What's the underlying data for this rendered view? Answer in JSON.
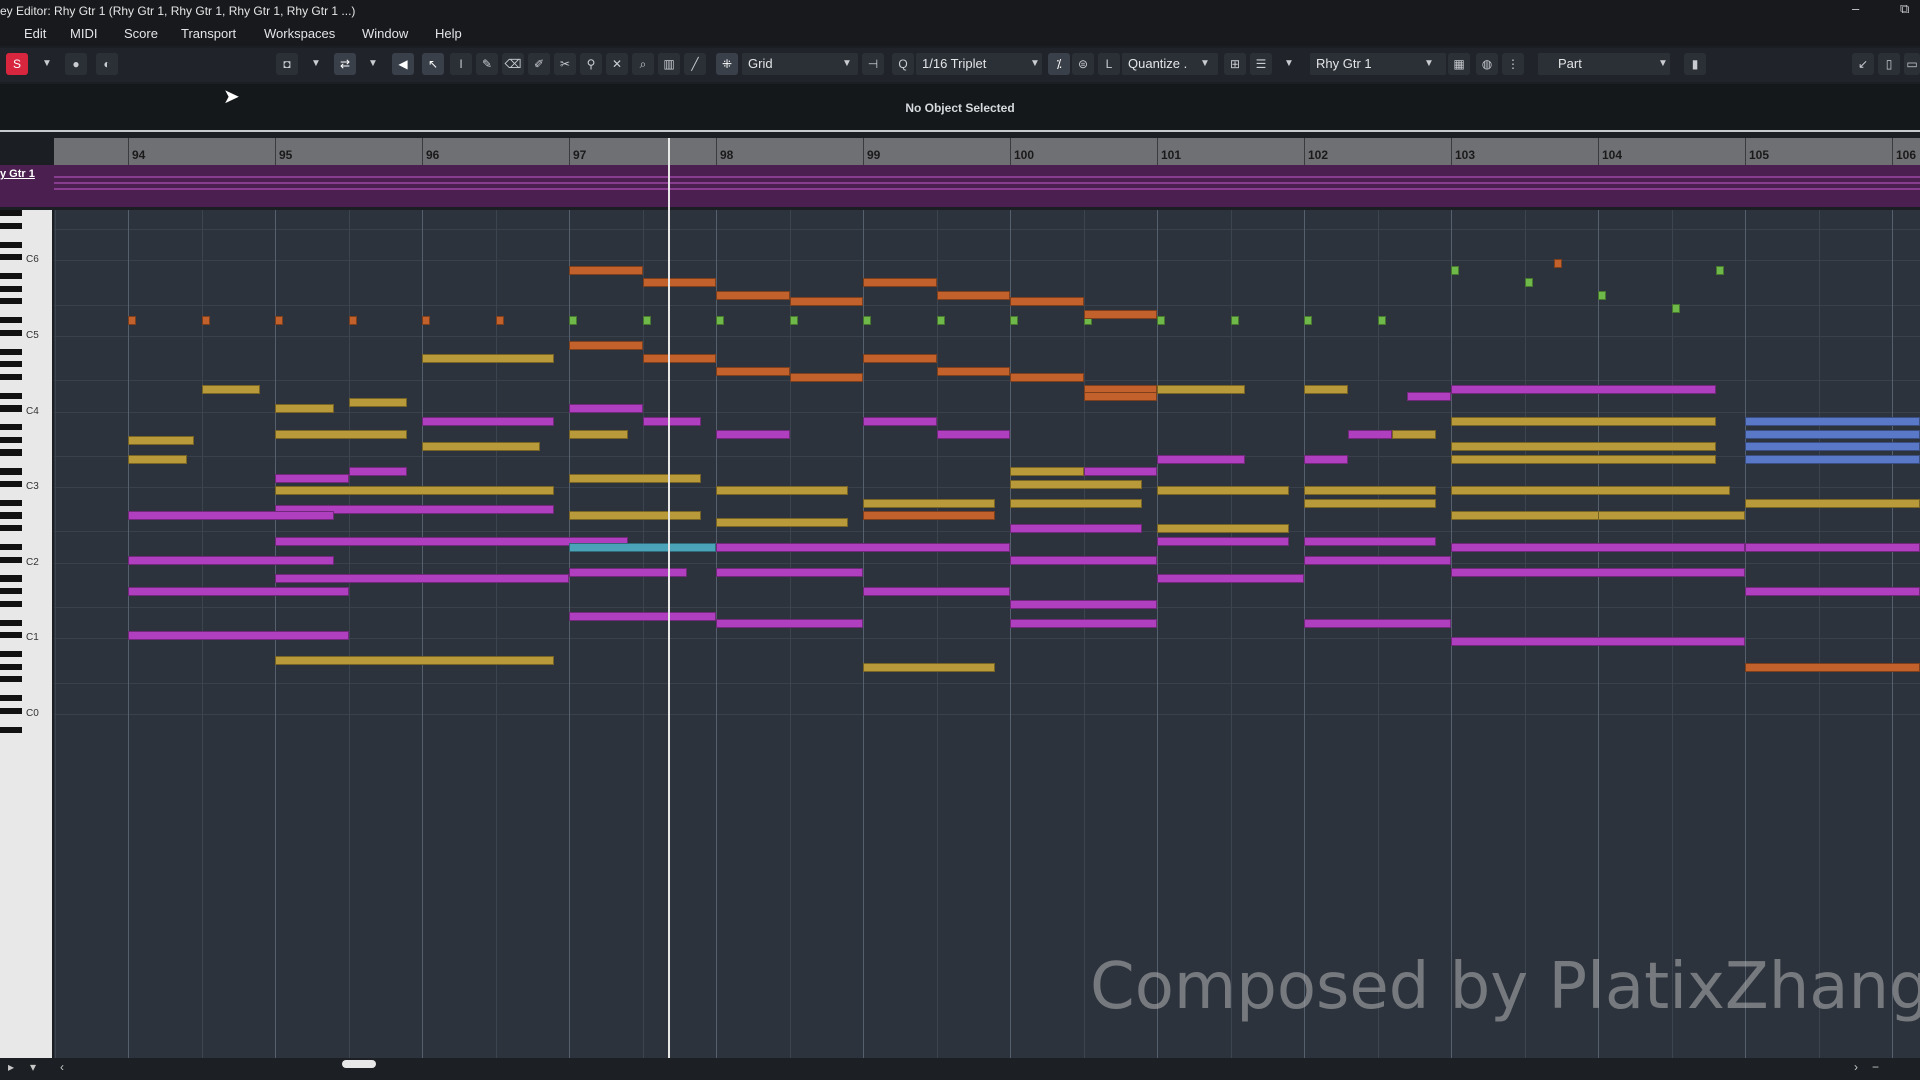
{
  "window": {
    "title": "ey Editor: Rhy Gtr 1 (Rhy Gtr 1, Rhy Gtr 1, Rhy Gtr 1, Rhy Gtr 1 ...)",
    "controls": [
      "–",
      "⧉"
    ]
  },
  "menu": [
    "Edit",
    "MIDI",
    "Score",
    "Transport",
    "Workspaces",
    "Window",
    "Help"
  ],
  "toolbar": {
    "grid_label": "Grid",
    "quantize_value": "1/16  Triplet",
    "quantize_label": "Quantize .",
    "track_select": "Rhy Gtr 1",
    "part_label": "Part",
    "q_icon": "Q",
    "l_icon": "L"
  },
  "info_line": "No Object Selected",
  "ruler": {
    "bars": [
      "94",
      "95",
      "96",
      "97",
      "98",
      "99",
      "100",
      "101",
      "102",
      "103",
      "104",
      "105",
      "106"
    ]
  },
  "track_label": "y Gtr 1",
  "keyboard": {
    "octave_labels": [
      "C6",
      "C5",
      "C4",
      "C3",
      "C2",
      "C1",
      "C0"
    ]
  },
  "watermark": "Composed by PlatixZhang",
  "colors": {
    "olive": "#b89a3a",
    "magenta": "#b03fbf",
    "orange": "#c2612c",
    "green": "#6fb84a",
    "blue": "#5a78c8",
    "teal": "#4aa3b8",
    "record": "#d8263f"
  },
  "notes": [
    {
      "bar": 94.0,
      "len": 0.05,
      "pitch": 75,
      "color": "orange"
    },
    {
      "bar": 94.5,
      "len": 0.05,
      "pitch": 75,
      "color": "orange"
    },
    {
      "bar": 95.0,
      "len": 0.05,
      "pitch": 75,
      "color": "orange"
    },
    {
      "bar": 95.5,
      "len": 0.05,
      "pitch": 75,
      "color": "orange"
    },
    {
      "bar": 96.0,
      "len": 0.05,
      "pitch": 75,
      "color": "orange"
    },
    {
      "bar": 96.5,
      "len": 0.05,
      "pitch": 75,
      "color": "orange"
    },
    {
      "bar": 97.0,
      "len": 0.05,
      "pitch": 75,
      "color": "green"
    },
    {
      "bar": 97.5,
      "len": 0.05,
      "pitch": 75,
      "color": "green"
    },
    {
      "bar": 98.0,
      "len": 0.05,
      "pitch": 75,
      "color": "green"
    },
    {
      "bar": 98.5,
      "len": 0.05,
      "pitch": 75,
      "color": "green"
    },
    {
      "bar": 99.0,
      "len": 0.05,
      "pitch": 75,
      "color": "green"
    },
    {
      "bar": 99.5,
      "len": 0.05,
      "pitch": 75,
      "color": "green"
    },
    {
      "bar": 100.0,
      "len": 0.05,
      "pitch": 75,
      "color": "green"
    },
    {
      "bar": 100.5,
      "len": 0.05,
      "pitch": 75,
      "color": "green"
    },
    {
      "bar": 101.0,
      "len": 0.05,
      "pitch": 75,
      "color": "green"
    },
    {
      "bar": 101.5,
      "len": 0.05,
      "pitch": 75,
      "color": "green"
    },
    {
      "bar": 102.0,
      "len": 0.05,
      "pitch": 75,
      "color": "green"
    },
    {
      "bar": 102.5,
      "len": 0.05,
      "pitch": 75,
      "color": "green"
    },
    {
      "bar": 103.7,
      "len": 0.05,
      "pitch": 84,
      "color": "orange"
    },
    {
      "bar": 104.8,
      "len": 0.05,
      "pitch": 83,
      "color": "green"
    },
    {
      "bar": 103.0,
      "len": 0.05,
      "pitch": 83,
      "color": "green"
    },
    {
      "bar": 103.5,
      "len": 0.05,
      "pitch": 81,
      "color": "green"
    },
    {
      "bar": 104.0,
      "len": 0.05,
      "pitch": 79,
      "color": "green"
    },
    {
      "bar": 104.5,
      "len": 0.05,
      "pitch": 77,
      "color": "green"
    },
    {
      "bar": 97.0,
      "len": 0.5,
      "pitch": 83,
      "color": "orange"
    },
    {
      "bar": 97.5,
      "len": 0.5,
      "pitch": 81,
      "color": "orange"
    },
    {
      "bar": 98.0,
      "len": 0.5,
      "pitch": 79,
      "color": "orange"
    },
    {
      "bar": 98.5,
      "len": 0.5,
      "pitch": 78,
      "color": "orange"
    },
    {
      "bar": 99.0,
      "len": 0.5,
      "pitch": 81,
      "color": "orange"
    },
    {
      "bar": 99.5,
      "len": 0.5,
      "pitch": 79,
      "color": "orange"
    },
    {
      "bar": 100.0,
      "len": 0.5,
      "pitch": 78,
      "color": "orange"
    },
    {
      "bar": 100.5,
      "len": 0.5,
      "pitch": 76,
      "color": "orange"
    },
    {
      "bar": 97.0,
      "len": 0.5,
      "pitch": 71,
      "color": "orange"
    },
    {
      "bar": 97.5,
      "len": 0.5,
      "pitch": 69,
      "color": "orange"
    },
    {
      "bar": 98.0,
      "len": 0.5,
      "pitch": 67,
      "color": "orange"
    },
    {
      "bar": 98.5,
      "len": 0.5,
      "pitch": 66,
      "color": "orange"
    },
    {
      "bar": 99.0,
      "len": 0.5,
      "pitch": 69,
      "color": "orange"
    },
    {
      "bar": 99.5,
      "len": 0.5,
      "pitch": 67,
      "color": "orange"
    },
    {
      "bar": 100.0,
      "len": 0.5,
      "pitch": 66,
      "color": "orange"
    },
    {
      "bar": 100.5,
      "len": 0.5,
      "pitch": 64,
      "color": "orange"
    },
    {
      "bar": 96.0,
      "len": 0.9,
      "pitch": 69,
      "color": "olive"
    },
    {
      "bar": 94.5,
      "len": 0.4,
      "pitch": 64,
      "color": "olive"
    },
    {
      "bar": 95.5,
      "len": 0.4,
      "pitch": 62,
      "color": "olive"
    },
    {
      "bar": 95.0,
      "len": 0.4,
      "pitch": 61,
      "color": "olive"
    },
    {
      "bar": 97.0,
      "len": 0.5,
      "pitch": 61,
      "color": "magenta"
    },
    {
      "bar": 96.0,
      "len": 0.9,
      "pitch": 59,
      "color": "magenta"
    },
    {
      "bar": 97.5,
      "len": 0.4,
      "pitch": 59,
      "color": "magenta"
    },
    {
      "bar": 99.0,
      "len": 0.5,
      "pitch": 59,
      "color": "magenta"
    },
    {
      "bar": 95.0,
      "len": 0.9,
      "pitch": 57,
      "color": "olive"
    },
    {
      "bar": 97.0,
      "len": 0.4,
      "pitch": 57,
      "color": "olive"
    },
    {
      "bar": 98.0,
      "len": 0.5,
      "pitch": 57,
      "color": "magenta"
    },
    {
      "bar": 99.5,
      "len": 0.5,
      "pitch": 57,
      "color": "magenta"
    },
    {
      "bar": 94.0,
      "len": 0.45,
      "pitch": 56,
      "color": "olive"
    },
    {
      "bar": 96.0,
      "len": 0.8,
      "pitch": 55,
      "color": "olive"
    },
    {
      "bar": 94.0,
      "len": 0.4,
      "pitch": 53,
      "color": "olive"
    },
    {
      "bar": 95.0,
      "len": 0.5,
      "pitch": 50,
      "color": "magenta"
    },
    {
      "bar": 95.5,
      "len": 0.4,
      "pitch": 51,
      "color": "magenta"
    },
    {
      "bar": 97.0,
      "len": 0.9,
      "pitch": 50,
      "color": "olive"
    },
    {
      "bar": 95.0,
      "len": 1.9,
      "pitch": 48,
      "color": "olive"
    },
    {
      "bar": 98.0,
      "len": 0.9,
      "pitch": 48,
      "color": "olive"
    },
    {
      "bar": 99.0,
      "len": 0.9,
      "pitch": 46,
      "color": "olive"
    },
    {
      "bar": 100.0,
      "len": 0.9,
      "pitch": 46,
      "color": "olive"
    },
    {
      "bar": 95.0,
      "len": 1.9,
      "pitch": 45,
      "color": "magenta"
    },
    {
      "bar": 94.0,
      "len": 1.4,
      "pitch": 44,
      "color": "magenta"
    },
    {
      "bar": 97.0,
      "len": 0.9,
      "pitch": 44,
      "color": "olive"
    },
    {
      "bar": 99.0,
      "len": 0.9,
      "pitch": 44,
      "color": "orange"
    },
    {
      "bar": 98.0,
      "len": 0.9,
      "pitch": 43,
      "color": "olive"
    },
    {
      "bar": 100.0,
      "len": 0.9,
      "pitch": 42,
      "color": "magenta"
    },
    {
      "bar": 101.0,
      "len": 0.9,
      "pitch": 42,
      "color": "olive"
    },
    {
      "bar": 95.0,
      "len": 2.4,
      "pitch": 40,
      "color": "magenta"
    },
    {
      "bar": 97.0,
      "len": 1.0,
      "pitch": 39,
      "color": "teal"
    },
    {
      "bar": 98.0,
      "len": 2.0,
      "pitch": 39,
      "color": "magenta"
    },
    {
      "bar": 94.0,
      "len": 1.4,
      "pitch": 37,
      "color": "magenta"
    },
    {
      "bar": 97.0,
      "len": 0.8,
      "pitch": 35,
      "color": "magenta"
    },
    {
      "bar": 95.0,
      "len": 2.0,
      "pitch": 34,
      "color": "magenta"
    },
    {
      "bar": 98.0,
      "len": 1.0,
      "pitch": 35,
      "color": "magenta"
    },
    {
      "bar": 94.0,
      "len": 1.5,
      "pitch": 32,
      "color": "magenta"
    },
    {
      "bar": 99.0,
      "len": 1.0,
      "pitch": 32,
      "color": "magenta"
    },
    {
      "bar": 100.0,
      "len": 1.0,
      "pitch": 30,
      "color": "magenta"
    },
    {
      "bar": 97.0,
      "len": 1.0,
      "pitch": 28,
      "color": "magenta"
    },
    {
      "bar": 98.0,
      "len": 1.0,
      "pitch": 27,
      "color": "magenta"
    },
    {
      "bar": 94.0,
      "len": 1.5,
      "pitch": 25,
      "color": "magenta"
    },
    {
      "bar": 95.0,
      "len": 1.9,
      "pitch": 21,
      "color": "olive"
    },
    {
      "bar": 99.0,
      "len": 0.9,
      "pitch": 20,
      "color": "olive"
    },
    {
      "bar": 101.0,
      "len": 0.9,
      "pitch": 48,
      "color": "olive"
    },
    {
      "bar": 102.0,
      "len": 0.9,
      "pitch": 48,
      "color": "olive"
    },
    {
      "bar": 103.0,
      "len": 1.9,
      "pitch": 48,
      "color": "olive"
    },
    {
      "bar": 102.0,
      "len": 0.9,
      "pitch": 46,
      "color": "olive"
    },
    {
      "bar": 103.0,
      "len": 1.9,
      "pitch": 44,
      "color": "olive"
    },
    {
      "bar": 104.0,
      "len": 1.0,
      "pitch": 44,
      "color": "olive"
    },
    {
      "bar": 101.0,
      "len": 0.9,
      "pitch": 40,
      "color": "magenta"
    },
    {
      "bar": 102.0,
      "len": 0.9,
      "pitch": 40,
      "color": "magenta"
    },
    {
      "bar": 103.0,
      "len": 2.0,
      "pitch": 39,
      "color": "magenta"
    },
    {
      "bar": 105.0,
      "len": 1.2,
      "pitch": 39,
      "color": "magenta"
    },
    {
      "bar": 100.0,
      "len": 1.0,
      "pitch": 37,
      "color": "magenta"
    },
    {
      "bar": 102.0,
      "len": 1.0,
      "pitch": 37,
      "color": "magenta"
    },
    {
      "bar": 103.0,
      "len": 2.0,
      "pitch": 35,
      "color": "magenta"
    },
    {
      "bar": 101.0,
      "len": 1.0,
      "pitch": 34,
      "color": "magenta"
    },
    {
      "bar": 105.0,
      "len": 1.2,
      "pitch": 32,
      "color": "magenta"
    },
    {
      "bar": 100.0,
      "len": 1.0,
      "pitch": 27,
      "color": "magenta"
    },
    {
      "bar": 102.0,
      "len": 1.0,
      "pitch": 27,
      "color": "magenta"
    },
    {
      "bar": 103.0,
      "len": 2.0,
      "pitch": 24,
      "color": "magenta"
    },
    {
      "bar": 103.0,
      "len": 1.8,
      "pitch": 64,
      "color": "magenta"
    },
    {
      "bar": 103.0,
      "len": 1.8,
      "pitch": 59,
      "color": "olive"
    },
    {
      "bar": 103.0,
      "len": 1.8,
      "pitch": 55,
      "color": "olive"
    },
    {
      "bar": 103.0,
      "len": 1.8,
      "pitch": 53,
      "color": "olive"
    },
    {
      "bar": 105.0,
      "len": 1.2,
      "pitch": 59,
      "color": "blue"
    },
    {
      "bar": 105.0,
      "len": 1.2,
      "pitch": 57,
      "color": "blue"
    },
    {
      "bar": 105.0,
      "len": 1.2,
      "pitch": 55,
      "color": "blue"
    },
    {
      "bar": 105.0,
      "len": 1.2,
      "pitch": 53,
      "color": "blue"
    },
    {
      "bar": 105.0,
      "len": 1.2,
      "pitch": 46,
      "color": "olive"
    },
    {
      "bar": 105.0,
      "len": 1.2,
      "pitch": 20,
      "color": "orange"
    },
    {
      "bar": 101.0,
      "len": 0.6,
      "pitch": 64,
      "color": "olive"
    },
    {
      "bar": 102.0,
      "len": 0.3,
      "pitch": 64,
      "color": "olive"
    },
    {
      "bar": 101.0,
      "len": 0.6,
      "pitch": 53,
      "color": "magenta"
    },
    {
      "bar": 102.0,
      "len": 0.3,
      "pitch": 53,
      "color": "magenta"
    },
    {
      "bar": 100.5,
      "len": 0.5,
      "pitch": 63,
      "color": "orange"
    },
    {
      "bar": 100.5,
      "len": 0.5,
      "pitch": 51,
      "color": "magenta"
    },
    {
      "bar": 100.0,
      "len": 0.5,
      "pitch": 51,
      "color": "olive"
    },
    {
      "bar": 100.0,
      "len": 0.9,
      "pitch": 49,
      "color": "olive"
    },
    {
      "bar": 102.3,
      "len": 0.3,
      "pitch": 57,
      "color": "magenta"
    },
    {
      "bar": 102.6,
      "len": 0.3,
      "pitch": 57,
      "color": "olive"
    },
    {
      "bar": 102.7,
      "len": 0.3,
      "pitch": 63,
      "color": "magenta"
    },
    {
      "bar": 101.0,
      "len": 0.6,
      "pitch": 53,
      "color": "magenta"
    }
  ]
}
